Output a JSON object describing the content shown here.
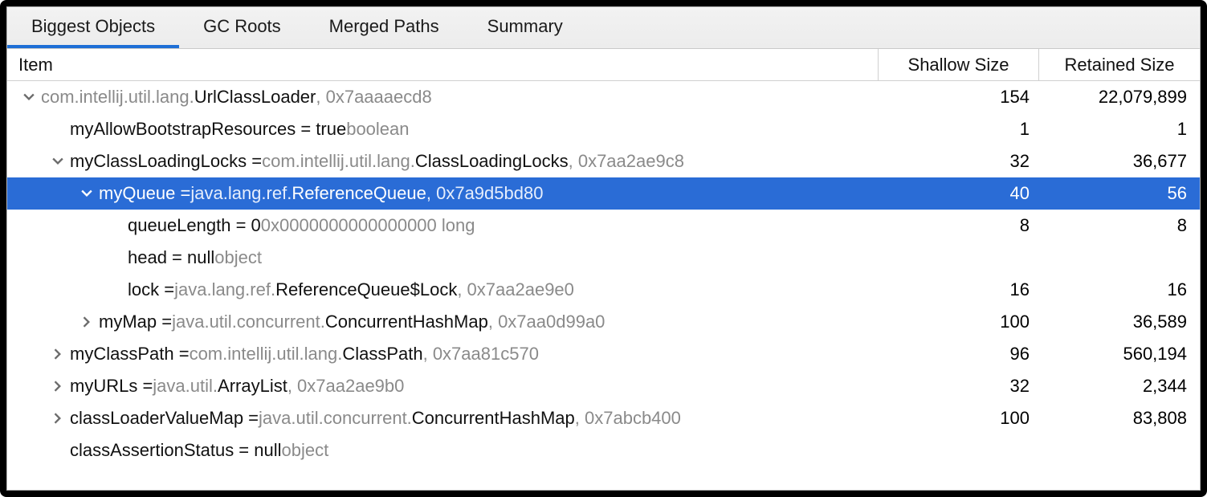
{
  "tabs": [
    {
      "label": "Biggest Objects",
      "active": true
    },
    {
      "label": "GC Roots",
      "active": false
    },
    {
      "label": "Merged Paths",
      "active": false
    },
    {
      "label": "Summary",
      "active": false
    }
  ],
  "columns": {
    "item": "Item",
    "shallow": "Shallow Size",
    "retained": "Retained Size"
  },
  "rows": [
    {
      "indent": 0,
      "arrow": "down",
      "selected": false,
      "parts": [
        {
          "t": "com.intellij.util.lang.",
          "cls": "dim"
        },
        {
          "t": "UrlClassLoader",
          "cls": "bold"
        },
        {
          "t": ", 0x7aaaaecd8",
          "cls": "dim"
        }
      ],
      "shallow": "154",
      "retained": "22,079,899"
    },
    {
      "indent": 1,
      "arrow": "none",
      "selected": false,
      "parts": [
        {
          "t": "myAllowBootstrapResources = true ",
          "cls": "bold"
        },
        {
          "t": "boolean",
          "cls": "dim"
        }
      ],
      "shallow": "1",
      "retained": "1"
    },
    {
      "indent": 1,
      "arrow": "down",
      "selected": false,
      "parts": [
        {
          "t": "myClassLoadingLocks = ",
          "cls": "bold"
        },
        {
          "t": "com.intellij.util.lang.",
          "cls": "dim"
        },
        {
          "t": "ClassLoadingLocks",
          "cls": "bold"
        },
        {
          "t": ", 0x7aa2ae9c8",
          "cls": "dim"
        }
      ],
      "shallow": "32",
      "retained": "36,677"
    },
    {
      "indent": 2,
      "arrow": "down",
      "selected": true,
      "parts": [
        {
          "t": "myQueue = ",
          "cls": "bold"
        },
        {
          "t": "java.lang.ref.",
          "cls": "dim"
        },
        {
          "t": "ReferenceQueue",
          "cls": "bold"
        },
        {
          "t": ", 0x7a9d5bd80",
          "cls": "dim"
        }
      ],
      "shallow": "40",
      "retained": "56"
    },
    {
      "indent": 3,
      "arrow": "none",
      "selected": false,
      "parts": [
        {
          "t": "queueLength = 0 ",
          "cls": "bold"
        },
        {
          "t": "0x0000000000000000  long",
          "cls": "dim"
        }
      ],
      "shallow": "8",
      "retained": "8"
    },
    {
      "indent": 3,
      "arrow": "none",
      "selected": false,
      "parts": [
        {
          "t": "head = null ",
          "cls": "bold"
        },
        {
          "t": "object",
          "cls": "dim"
        }
      ],
      "shallow": "",
      "retained": ""
    },
    {
      "indent": 3,
      "arrow": "none",
      "selected": false,
      "parts": [
        {
          "t": "lock = ",
          "cls": "bold"
        },
        {
          "t": "java.lang.ref.",
          "cls": "dim"
        },
        {
          "t": "ReferenceQueue$Lock",
          "cls": "bold"
        },
        {
          "t": ", 0x7aa2ae9e0",
          "cls": "dim"
        }
      ],
      "shallow": "16",
      "retained": "16"
    },
    {
      "indent": 2,
      "arrow": "right",
      "selected": false,
      "parts": [
        {
          "t": "myMap = ",
          "cls": "bold"
        },
        {
          "t": "java.util.concurrent.",
          "cls": "dim"
        },
        {
          "t": "ConcurrentHashMap",
          "cls": "bold"
        },
        {
          "t": ", 0x7aa0d99a0",
          "cls": "dim"
        }
      ],
      "shallow": "100",
      "retained": "36,589"
    },
    {
      "indent": 1,
      "arrow": "right",
      "selected": false,
      "parts": [
        {
          "t": "myClassPath = ",
          "cls": "bold"
        },
        {
          "t": "com.intellij.util.lang.",
          "cls": "dim"
        },
        {
          "t": "ClassPath",
          "cls": "bold"
        },
        {
          "t": ", 0x7aa81c570",
          "cls": "dim"
        }
      ],
      "shallow": "96",
      "retained": "560,194"
    },
    {
      "indent": 1,
      "arrow": "right",
      "selected": false,
      "parts": [
        {
          "t": "myURLs = ",
          "cls": "bold"
        },
        {
          "t": "java.util.",
          "cls": "dim"
        },
        {
          "t": "ArrayList",
          "cls": "bold"
        },
        {
          "t": ", 0x7aa2ae9b0",
          "cls": "dim"
        }
      ],
      "shallow": "32",
      "retained": "2,344"
    },
    {
      "indent": 1,
      "arrow": "right",
      "selected": false,
      "parts": [
        {
          "t": "classLoaderValueMap = ",
          "cls": "bold"
        },
        {
          "t": "java.util.concurrent.",
          "cls": "dim"
        },
        {
          "t": "ConcurrentHashMap",
          "cls": "bold"
        },
        {
          "t": ", 0x7abcb400",
          "cls": "dim"
        }
      ],
      "shallow": "100",
      "retained": "83,808"
    },
    {
      "indent": 1,
      "arrow": "none",
      "selected": false,
      "parts": [
        {
          "t": "classAssertionStatus = null ",
          "cls": "bold"
        },
        {
          "t": "object",
          "cls": "dim"
        }
      ],
      "shallow": "",
      "retained": ""
    }
  ]
}
